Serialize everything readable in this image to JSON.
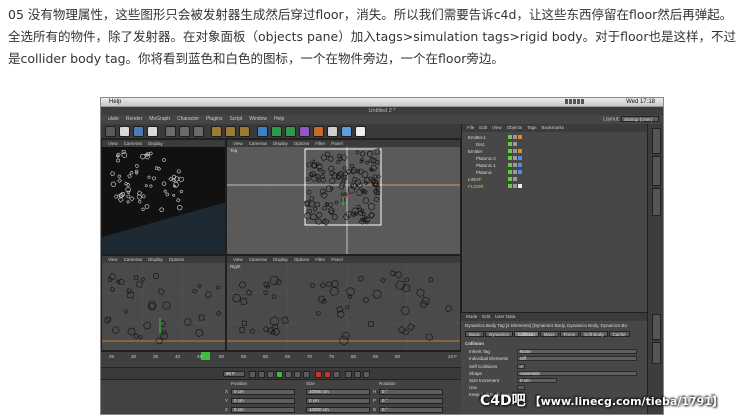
{
  "article": {
    "text": "05 没有物理属性，这些图形只会被发射器生成然后穿过floor，消失。所以我们需要告诉c4d，让这些东西停留在floor然后再弹起。全选所有的物件，除了发射器。在对象面板（objects pane）加入tags>simulation tags>rigid body。对于floor也是这样，不过是collider body tag。你将看到蓝色和白色的图标，一个在物件旁边，一个在floor旁边。"
  },
  "mac": {
    "menu": "Help",
    "clock": "Wed 17:18"
  },
  "window": {
    "title": "Untitled 2 *",
    "menus": [
      "ulate",
      "Render",
      "MoGraph",
      "Character",
      "Plugins",
      "Script",
      "Window",
      "Help"
    ],
    "layout_label": "Layout:",
    "layout_value": "Startup (User)"
  },
  "viewport_menu": [
    "View",
    "Cameras",
    "Display",
    "Options",
    "Filter",
    "Panel"
  ],
  "viewports": {
    "top_name": "Top",
    "right_name": "Right"
  },
  "objects": {
    "menu": [
      "File",
      "Edit",
      "View",
      "Objects",
      "Tags",
      "Bookmarks"
    ],
    "items": [
      {
        "name": "Emitter.1",
        "indent": 0
      },
      {
        "name": "Disc",
        "indent": 1
      },
      {
        "name": "Emitter",
        "indent": 0
      },
      {
        "name": "Platonic.2",
        "indent": 1
      },
      {
        "name": "Platonic.1",
        "indent": 1
      },
      {
        "name": "Platonic",
        "indent": 1
      },
      {
        "name": "LIGHT",
        "indent": 0
      },
      {
        "name": "FLOOR",
        "indent": 0
      }
    ]
  },
  "attributes": {
    "menu": [
      "Mode",
      "Edit",
      "User Data"
    ],
    "title": "Dynamics Body Tag [4 Elements] (Dynamics Body, Dynamics Body, Dynamics Bo",
    "tabs": [
      "Basic",
      "Dynamics",
      "Collision",
      "Mass",
      "Force",
      "Soft Body",
      "Cache"
    ],
    "active_tab": "Collision",
    "section": "Collision",
    "rows": [
      {
        "k": "Inherit Tag",
        "v": "None"
      },
      {
        "k": "Individual Elements",
        "v": "Off"
      },
      {
        "k": "Self Collisions",
        "v": "✓"
      },
      {
        "k": "Shape",
        "v": "Automatic"
      },
      {
        "k": "Size Increment",
        "v": "0 cm"
      },
      {
        "k": "Use",
        "v": ""
      },
      {
        "k": "Keep Soft Body Shape",
        "v": ""
      }
    ]
  },
  "timeline": {
    "ticks": [
      "25",
      "30",
      "35",
      "40",
      "45",
      "50",
      "55",
      "60",
      "65",
      "70",
      "75",
      "80",
      "85",
      "90"
    ],
    "end_label": "23 F",
    "current_frame": "90 F"
  },
  "coords": {
    "headers": [
      "Position",
      "Size",
      "Rotation"
    ],
    "rows": [
      {
        "axis": "X",
        "pos": "0 cm",
        "size": "10000 cm",
        "rot_axis": "H",
        "rot": "0 °"
      },
      {
        "axis": "Y",
        "pos": "0 cm",
        "size": "0 cm",
        "rot_axis": "P",
        "rot": "0 °"
      },
      {
        "axis": "Z",
        "pos": "0 cm",
        "size": "10000 cm",
        "rot_axis": "B",
        "rot": "0 °"
      }
    ]
  },
  "watermark": {
    "brand": "C4D吧",
    "url": "【www.linecg.com/tieba/1791】"
  }
}
